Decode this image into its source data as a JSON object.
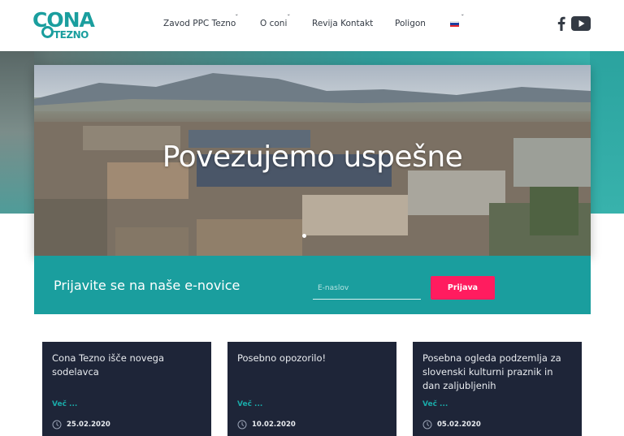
{
  "logo": {
    "line1": "CONA",
    "line2": "TEZNO"
  },
  "nav": {
    "items": [
      {
        "label": "Zavod PPC Tezno",
        "has_dropdown": true
      },
      {
        "label": "O coni",
        "has_dropdown": true
      },
      {
        "label": "Revija Kontakt",
        "has_dropdown": false
      },
      {
        "label": "Poligon",
        "has_dropdown": false
      }
    ],
    "language_icon": "slovenian-flag-icon",
    "social": [
      "facebook-icon",
      "youtube-icon"
    ]
  },
  "hero": {
    "title": "Povezujemo uspešne",
    "slides_visible": 1
  },
  "newsletter": {
    "title": "Prijavite se na naše e-novice",
    "input_placeholder": "E-naslov",
    "button_label": "Prijava"
  },
  "news": [
    {
      "title": "Cona Tezno išče novega sodelavca",
      "more": "Več ...",
      "date": "25.02.2020"
    },
    {
      "title": "Posebno opozorilo!",
      "more": "Več ...",
      "date": "10.02.2020"
    },
    {
      "title": "Posebna ogleda podzemlja za slovenski kulturni praznik in dan zaljubljenih",
      "more": "Več ...",
      "date": "05.02.2020"
    }
  ],
  "colors": {
    "brand_teal": "#1a9e9e",
    "button_pink": "#ff1c5f",
    "card_bg": "#1e2538"
  }
}
